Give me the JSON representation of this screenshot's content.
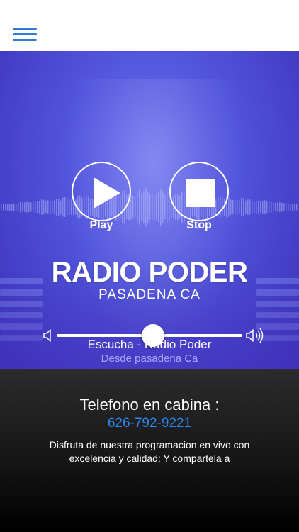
{
  "header": {
    "menu_icon": "hamburger-menu-icon",
    "accent": "#2f7bd9"
  },
  "player": {
    "play_label": "Play",
    "stop_label": "Stop",
    "play_icon": "play-icon",
    "stop_icon": "stop-icon",
    "volume_low_icon": "volume-low-icon",
    "volume_high_icon": "volume-high-icon",
    "volume_level": 0.52
  },
  "station": {
    "logo_title": "RADIO PODER",
    "logo_subtitle": "PASADENA CA",
    "track_title": "Escucha - Radio Poder",
    "track_subtitle": "Desde pasadena Ca"
  },
  "info": {
    "phone_heading": "Telefono en cabina :",
    "phone_number": "626-792-9221",
    "description": "Disfruta de nuestra programacion en vivo con excelencia y calidad; Y compartela a"
  },
  "colors": {
    "hero_bg": "#4f52d9",
    "link": "#2f86e6",
    "subtitle": "#a9a7ff"
  }
}
